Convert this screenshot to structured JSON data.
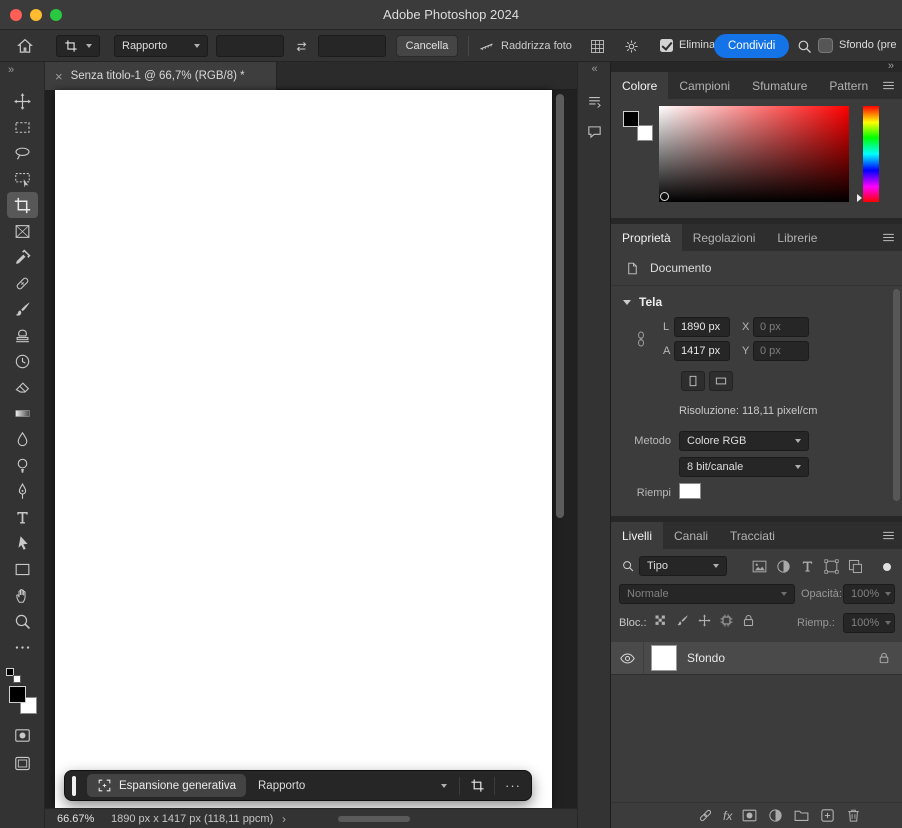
{
  "titlebar": {
    "title": "Adobe Photoshop 2024"
  },
  "options_bar": {
    "ratio_preset": "Rapporto",
    "width_value": "",
    "height_value": "",
    "clear_button": "Cancella",
    "straighten_label": "Raddrizza foto",
    "delete_label": "Elimina",
    "share_button": "Condividi",
    "preset_search_value": "Sfondo (pre"
  },
  "document_tab": {
    "close": "×",
    "title": "Senza titolo-1 @ 66,7% (RGB/8) *"
  },
  "toolbar": {
    "expand_glyph": "»",
    "selected_tool": "crop-tool",
    "tools": [
      "move-tool",
      "rectangular-marquee-tool",
      "lasso-tool",
      "object-selection-tool",
      "crop-tool",
      "frame-tool",
      "eyedropper-tool",
      "spot-healing-brush-tool",
      "brush-tool",
      "clone-stamp-tool",
      "history-brush-tool",
      "eraser-tool",
      "gradient-tool",
      "blur-tool",
      "dodge-tool",
      "pen-tool",
      "type-tool",
      "path-selection-tool",
      "rectangle-tool",
      "hand-tool",
      "zoom-tool",
      "edit-toolbar"
    ]
  },
  "right_dock": {
    "collapse_glyph": "«"
  },
  "panels_collapse_glyph": "»",
  "color_panel": {
    "tabs": [
      "Colore",
      "Campioni",
      "Sfumature",
      "Pattern"
    ],
    "active_tab": "Colore"
  },
  "properties_panel": {
    "tabs": [
      "Proprietà",
      "Regolazioni",
      "Librerie"
    ],
    "active_tab": "Proprietà",
    "document_label": "Documento",
    "canvas_section": "Tela",
    "width_label": "L",
    "width_value": "1890 px",
    "x_label": "X",
    "x_value": "0 px",
    "height_label": "A",
    "height_value": "1417 px",
    "y_label": "Y",
    "y_value": "0 px",
    "resolution": "Risoluzione: 118,11 pixel/cm",
    "mode_label": "Metodo",
    "mode_value": "Colore RGB",
    "depth_value": "8 bit/canale",
    "fill_label": "Riempi"
  },
  "layers_panel": {
    "tabs": [
      "Livelli",
      "Canali",
      "Tracciati"
    ],
    "active_tab": "Livelli",
    "filter_type": "Tipo",
    "blend_mode": "Normale",
    "opacity_label": "Opacità:",
    "opacity_value": "100%",
    "lock_label": "Bloc.:",
    "fill_label": "Riemp.:",
    "fill_value": "100%",
    "fx_label": "fx",
    "layers": [
      {
        "name": "Sfondo",
        "visible": true,
        "locked": true
      }
    ]
  },
  "task_bar": {
    "generative_expand": "Espansione generativa",
    "ratio_select": "Rapporto",
    "more_glyph": "···"
  },
  "status_bar": {
    "zoom": "66.67%",
    "dimensions": "1890 px x 1417 px (118,11 ppcm)",
    "expand_glyph": "›"
  },
  "colors": {
    "accent_blue": "#1473e6",
    "foreground": "#000000",
    "background": "#ffffff",
    "canvas_fill": "#ffffff"
  }
}
